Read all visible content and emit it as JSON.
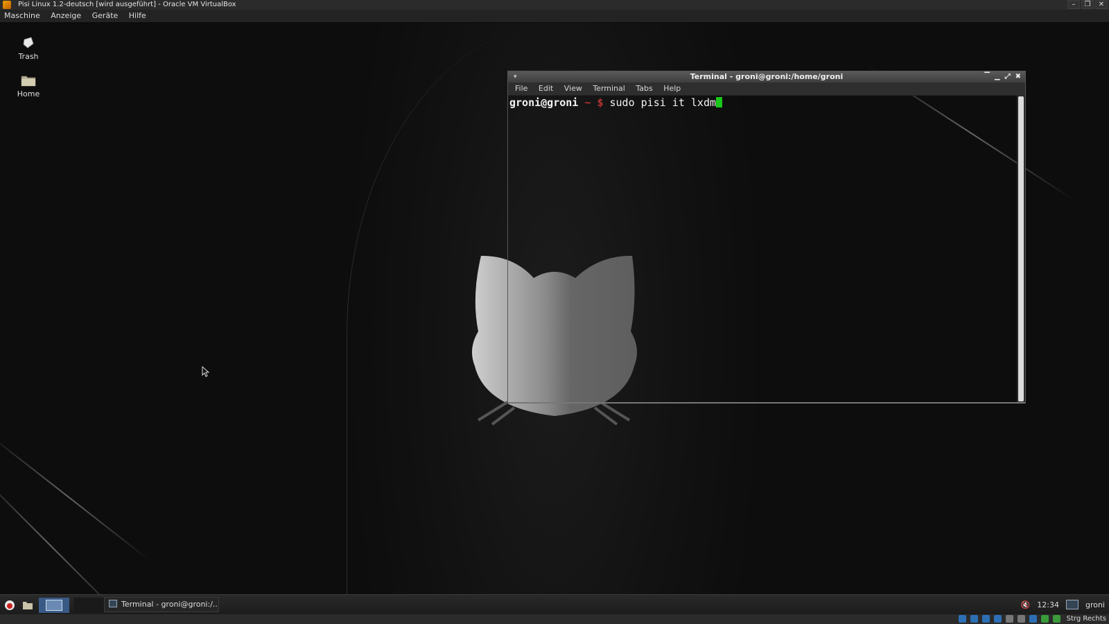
{
  "host_window": {
    "title": "Pisi Linux 1.2-deutsch [wird ausgeführt] - Oracle VM VirtualBox",
    "menu": [
      "Maschine",
      "Anzeige",
      "Geräte",
      "Hilfe"
    ],
    "status_host_key": "Strg Rechts"
  },
  "desktop": {
    "icons": [
      {
        "label": "Trash",
        "icon": "trash-icon"
      },
      {
        "label": "Home",
        "icon": "folder-icon"
      }
    ]
  },
  "terminal": {
    "title": "Terminal - groni@groni:/home/groni",
    "menu": [
      "File",
      "Edit",
      "View",
      "Terminal",
      "Tabs",
      "Help"
    ],
    "prompt_user": "groni@groni",
    "prompt_dir": "~",
    "prompt_symbol": "$",
    "command": "sudo pisi it lxdm",
    "cursor_color": "#19c819"
  },
  "taskbar": {
    "task_label": "Terminal - groni@groni:/...",
    "clock": "12:34",
    "user": "groni"
  },
  "colors": {
    "desktop_bg": "#111111",
    "prompt_accent": "#bb3333",
    "workspace_active": "#3a5a86"
  }
}
